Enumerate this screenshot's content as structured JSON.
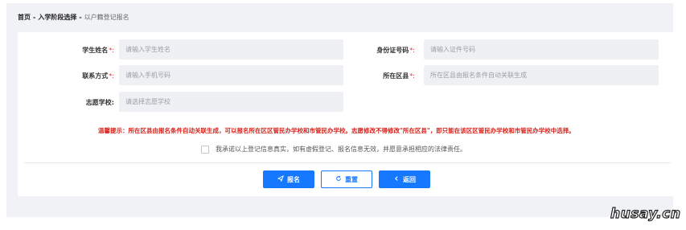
{
  "breadcrumb": {
    "home": "首页",
    "separator": "-",
    "stage": "入学阶段选择",
    "current": "以户籍登记报名"
  },
  "form": {
    "student_name": {
      "label": "学生姓名",
      "required_mark": "*:",
      "placeholder": "请输入学生姓名"
    },
    "id_number": {
      "label": "身份证号码",
      "required_mark": "*:",
      "placeholder": "请输入证件号码"
    },
    "contact": {
      "label": "联系方式",
      "required_mark": "*:",
      "placeholder": "请输入手机号码"
    },
    "district": {
      "label": "所在区县",
      "required_mark": "*:",
      "placeholder": "所在区县由报名条件自动关联生成"
    },
    "school": {
      "label": "志愿学校",
      "required_mark": ":",
      "placeholder": "请选择志愿学校"
    }
  },
  "hint": "温馨提示：所在区县由报名条件自动关联生成，可以报名所在区区管民办学校和市管民办学校。志愿修改不得修改\"所在区县\"，即只能在该区区管民办学校和市管民办学校中选择。",
  "agreement": {
    "checked": false,
    "text": "我承诺以上登记信息真实，如有虚假登记、报名信息无效，并愿意承担相应的法律责任。"
  },
  "buttons": {
    "submit": {
      "label": "报名",
      "icon": "send-icon"
    },
    "reset": {
      "label": "重置",
      "icon": "refresh-icon"
    },
    "back": {
      "label": "返回",
      "icon": "chevron-left-icon"
    }
  },
  "colors": {
    "primary": "#1677ff",
    "hint": "#d9231c",
    "required": "#e03030",
    "background": "#f0f2f5"
  },
  "watermark": "husay.cn"
}
